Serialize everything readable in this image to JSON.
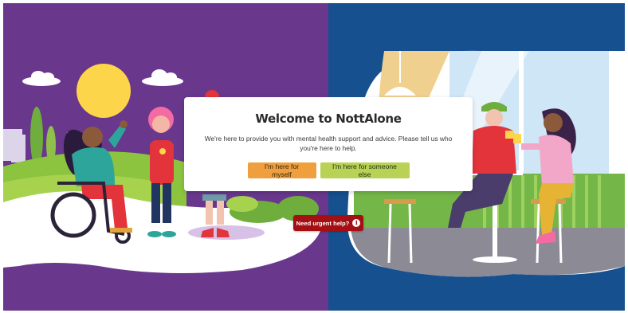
{
  "welcome": {
    "title": "Welcome to NottAlone",
    "description": "We're here to provide you with mental health support and advice. Please tell us who you're here to help.",
    "button_myself": "I'm here for myself",
    "button_someone_else": "I'm here for someone else"
  },
  "urgent_help": {
    "label": "Need urgent help?",
    "icon": "info-icon"
  },
  "colors": {
    "left_panel": "#69378c",
    "right_panel": "#17508f",
    "myself_button": "#ef9f3d",
    "someone_else_button": "#b9d154",
    "urgent_button": "#a30f12"
  }
}
